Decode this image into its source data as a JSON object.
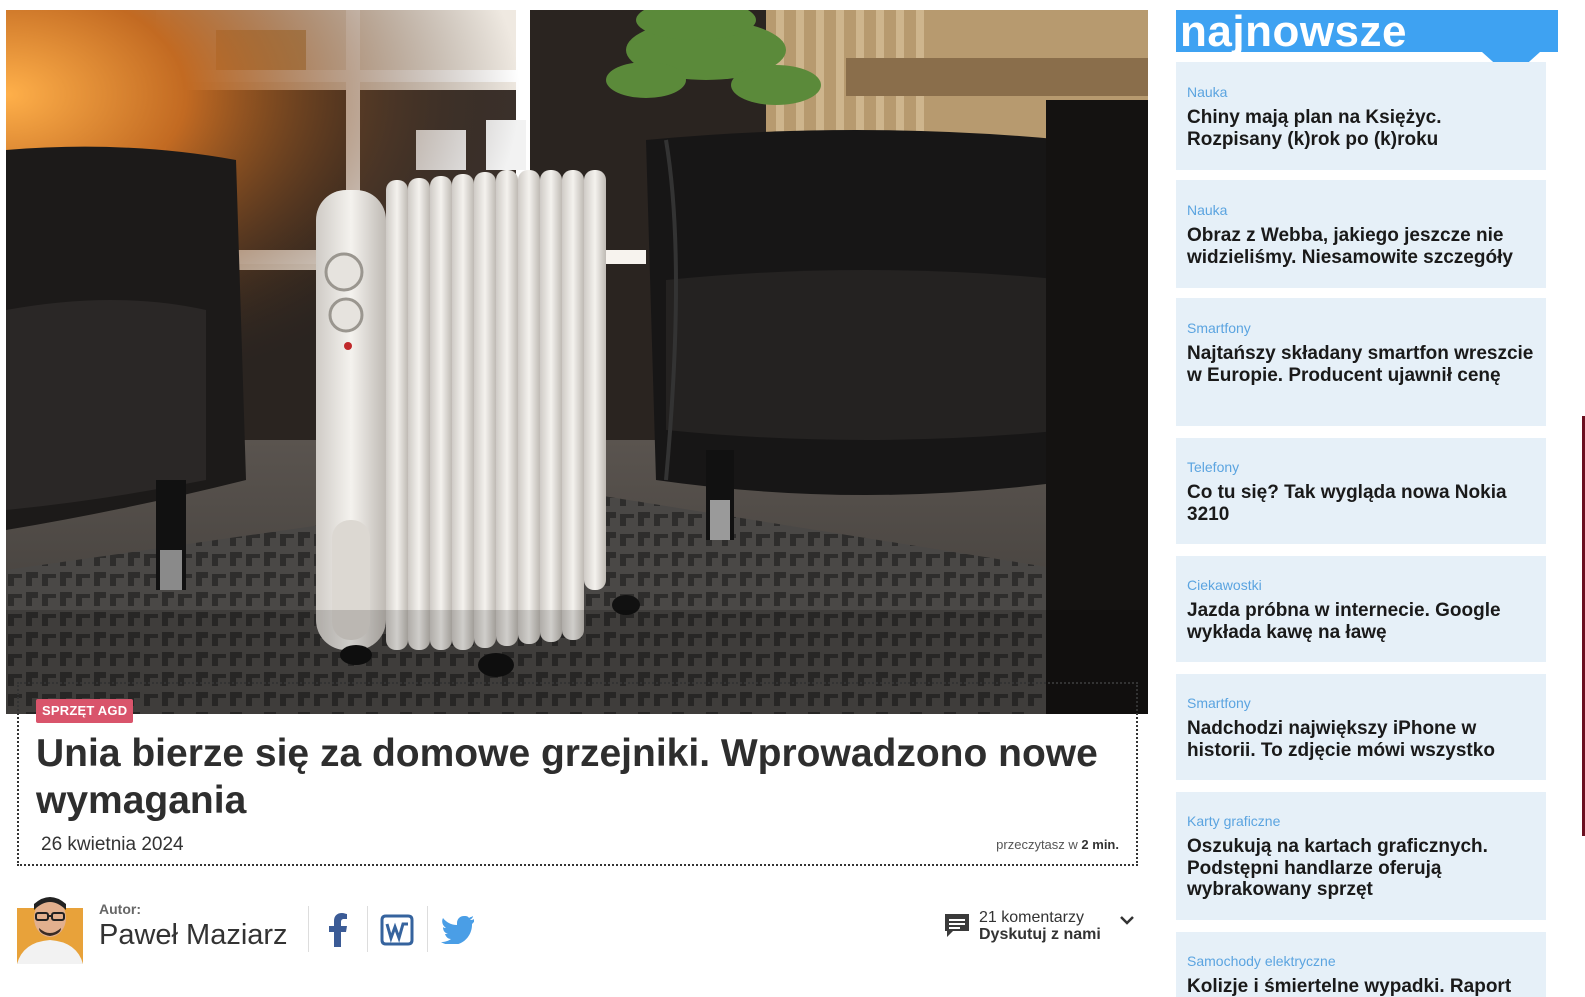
{
  "article": {
    "category": "SPRZĘT AGD",
    "title": "Unia bierze się za domowe grzejniki. Wprowadzono nowe wymagania",
    "date": "26 kwietnia 2024",
    "read_time_prefix": "przeczytasz w",
    "read_time_value": "2 min."
  },
  "author": {
    "label": "Autor:",
    "name": "Paweł Maziarz"
  },
  "social": {
    "icons": [
      "facebook-icon",
      "wykop-icon",
      "twitter-icon"
    ]
  },
  "comments": {
    "count_text": "21 komentarzy",
    "cta": "Dyskutuj z nami"
  },
  "sidebar": {
    "header": "najnowsze",
    "items": [
      {
        "category": "Nauka",
        "title": "Chiny mają plan na Księżyc. Rozpisany (k)rok po (k)roku"
      },
      {
        "category": "Nauka",
        "title": "Obraz z Webba, jakiego jeszcze nie widzieliśmy. Niesamowite szczegóły"
      },
      {
        "category": "Smartfony",
        "title": "Najtańszy składany smartfon wreszcie w Europie. Producent ujawnił cenę"
      },
      {
        "category": "Telefony",
        "title": "Co tu się? Tak wygląda nowa Nokia 3210"
      },
      {
        "category": "Ciekawostki",
        "title": "Jazda próbna w internecie. Google wykłada kawę na ławę"
      },
      {
        "category": "Smartfony",
        "title": "Nadchodzi największy iPhone w historii. To zdjęcie mówi wszystko"
      },
      {
        "category": "Karty graficzne",
        "title": "Oszukują na kartach graficznych. Podstępni handlarze oferują wybrakowany sprzęt"
      },
      {
        "category": "Samochody elektryczne",
        "title": "Kolizje i śmiertelne wypadki. Raport"
      }
    ]
  },
  "colors": {
    "accent_blue": "#3ea2f2",
    "badge_red": "#d9546b",
    "news_bg": "#e6f0f8",
    "news_category": "#5ba4e0"
  }
}
